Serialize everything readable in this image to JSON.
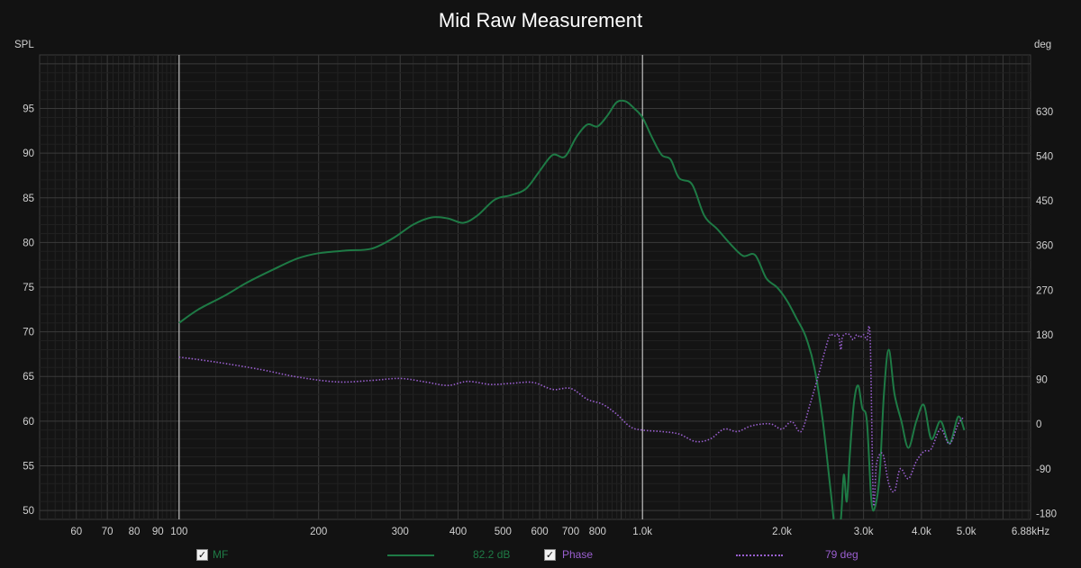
{
  "chart_data": {
    "type": "line",
    "title": "Mid Raw Measurement",
    "y_left_label": "SPL",
    "y_right_label": "deg",
    "x_scale": "log",
    "xlim": [
      50,
      6880
    ],
    "ylim_left": [
      49,
      101
    ],
    "ylim_right": [
      -192,
      744
    ],
    "x_tick_labels": [
      {
        "v": 60,
        "t": "60"
      },
      {
        "v": 70,
        "t": "70"
      },
      {
        "v": 80,
        "t": "80"
      },
      {
        "v": 90,
        "t": "90"
      },
      {
        "v": 100,
        "t": "100"
      },
      {
        "v": 200,
        "t": "200"
      },
      {
        "v": 300,
        "t": "300"
      },
      {
        "v": 400,
        "t": "400"
      },
      {
        "v": 500,
        "t": "500"
      },
      {
        "v": 600,
        "t": "600"
      },
      {
        "v": 700,
        "t": "700"
      },
      {
        "v": 800,
        "t": "800"
      },
      {
        "v": 1000,
        "t": "1.0k"
      },
      {
        "v": 2000,
        "t": "2.0k"
      },
      {
        "v": 3000,
        "t": "3.0k"
      },
      {
        "v": 4000,
        "t": "4.0k"
      },
      {
        "v": 5000,
        "t": "5.0k"
      },
      {
        "v": 6880,
        "t": "6.88kHz"
      }
    ],
    "y_left_ticks": [
      50,
      55,
      60,
      65,
      70,
      75,
      80,
      85,
      90,
      95
    ],
    "y_right_ticks": [
      -180,
      -90,
      0,
      90,
      180,
      270,
      360,
      450,
      540,
      630
    ],
    "cursor_x": [
      100,
      1000
    ],
    "grid": true,
    "series": [
      {
        "name": "MF",
        "axis": "left",
        "color": "#1e7a45",
        "style": "solid",
        "legend_value": "82.2 dB",
        "x": [
          100,
          110,
          125,
          140,
          160,
          180,
          200,
          230,
          260,
          290,
          320,
          350,
          380,
          410,
          440,
          480,
          520,
          560,
          600,
          640,
          680,
          720,
          760,
          800,
          840,
          880,
          920,
          960,
          1000,
          1050,
          1100,
          1150,
          1200,
          1280,
          1360,
          1450,
          1550,
          1650,
          1750,
          1850,
          1950,
          2050,
          2150,
          2250,
          2350,
          2450,
          2550,
          2620,
          2680,
          2720,
          2760,
          2800,
          2860,
          2920,
          2980,
          3050,
          3120,
          3180,
          3250,
          3320,
          3400,
          3500,
          3620,
          3750,
          3900,
          4050,
          4200,
          4400,
          4600,
          4800,
          4950
        ],
        "y": [
          71,
          72.5,
          74,
          75.5,
          77,
          78.2,
          78.8,
          79.1,
          79.3,
          80.5,
          82,
          82.8,
          82.7,
          82.2,
          83,
          84.8,
          85.3,
          86,
          88,
          89.8,
          89.6,
          91.8,
          93.2,
          93,
          94.2,
          95.7,
          95.8,
          95,
          94,
          91.7,
          89.8,
          89.3,
          87.2,
          86.5,
          83,
          81.5,
          79.8,
          78.5,
          78.6,
          76,
          75,
          73.5,
          71.5,
          69.5,
          66,
          60,
          52,
          47,
          49,
          54,
          51,
          56,
          62,
          64,
          61.5,
          60,
          51,
          50.5,
          54,
          63,
          68,
          63,
          60,
          57,
          60,
          61.8,
          58,
          60,
          57.5,
          60.5,
          59
        ]
      },
      {
        "name": "Phase",
        "axis": "right",
        "color": "#9a5fd0",
        "style": "dotted",
        "legend_value": "79 deg",
        "x": [
          100,
          120,
          150,
          180,
          220,
          260,
          300,
          340,
          380,
          420,
          470,
          520,
          580,
          640,
          700,
          760,
          820,
          880,
          940,
          1000,
          1100,
          1200,
          1300,
          1400,
          1500,
          1600,
          1700,
          1800,
          1900,
          2000,
          2100,
          2200,
          2300,
          2400,
          2480,
          2540,
          2580,
          2620,
          2650,
          2680,
          2700,
          2750,
          2800,
          2850,
          2900,
          2950,
          3000,
          3050,
          3100,
          3150,
          3200,
          3300,
          3400,
          3500,
          3600,
          3750,
          3900,
          4050,
          4200,
          4400,
          4600,
          4800,
          4950
        ],
        "y": [
          135,
          125,
          110,
          95,
          85,
          88,
          92,
          85,
          78,
          86,
          80,
          82,
          84,
          70,
          72,
          50,
          40,
          20,
          -5,
          -12,
          -15,
          -20,
          -35,
          -30,
          -10,
          -15,
          -5,
          0,
          0,
          -10,
          5,
          -15,
          40,
          100,
          150,
          180,
          178,
          178,
          180,
          150,
          175,
          182,
          180,
          170,
          180,
          175,
          180,
          170,
          175,
          -155,
          -80,
          -60,
          -120,
          -135,
          -90,
          -110,
          -75,
          -55,
          -50,
          -10,
          -40,
          0,
          15
        ]
      }
    ]
  },
  "legend": [
    {
      "checkbox": "✓",
      "name": "MF",
      "value": "82.2 dB"
    },
    {
      "checkbox": "✓",
      "name": "Phase",
      "value": "79 deg"
    }
  ]
}
